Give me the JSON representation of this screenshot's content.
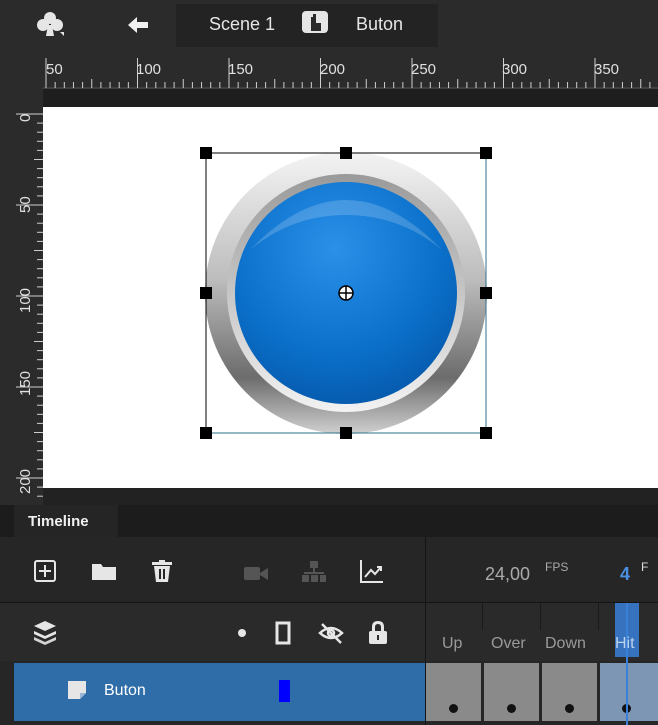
{
  "breadcrumb": {
    "scene_label": "Scene 1",
    "symbol_label": "Buton",
    "icons": [
      "club-icon",
      "back-arrow-icon",
      "button-symbol-icon"
    ]
  },
  "rulers": {
    "horizontal_ticks": [
      "50",
      "100",
      "150",
      "200",
      "250",
      "300",
      "350"
    ],
    "vertical_ticks": [
      "0",
      "50",
      "100",
      "150",
      "200"
    ]
  },
  "stage": {
    "symbol": "blue-round-button",
    "colors": {
      "button_fill": "#0a6fc9",
      "ring": "#c8c8c8",
      "selection": "#000000"
    }
  },
  "timeline": {
    "tab_label": "Timeline",
    "tools": [
      "add-layer-icon",
      "folder-icon",
      "trash-icon",
      "camera-icon",
      "hierarchy-icon",
      "graph-icon"
    ],
    "fps_value": "24,00",
    "fps_label": "FPS",
    "current_frame": "4",
    "frame_suffix": "F",
    "column_icons": [
      "dot-icon",
      "outline-icon",
      "visibility-off-icon",
      "lock-icon"
    ],
    "frames": [
      {
        "label": "Up"
      },
      {
        "label": "Over"
      },
      {
        "label": "Down"
      },
      {
        "label": "Hit"
      }
    ],
    "layers": [
      {
        "name": "Buton",
        "color": "#0000ff"
      }
    ],
    "accent": "#3a7fd8"
  }
}
